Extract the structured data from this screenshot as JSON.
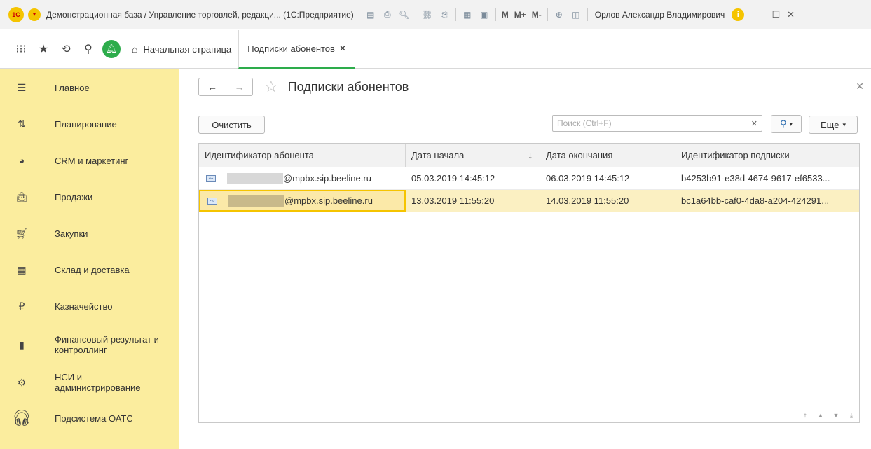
{
  "titlebar": {
    "logo": "1С",
    "title": "Демонстрационная база / Управление торговлей, редакци... (1С:Предприятие)",
    "m_label": "M",
    "mplus_label": "M+",
    "mminus_label": "M-",
    "user": "Орлов Александр Владимирович"
  },
  "tabs": {
    "home": "Начальная страница",
    "active": "Подписки абонентов"
  },
  "sidebar": {
    "items": [
      {
        "label": "Главное"
      },
      {
        "label": "Планирование"
      },
      {
        "label": "CRM и маркетинг"
      },
      {
        "label": "Продажи"
      },
      {
        "label": "Закупки"
      },
      {
        "label": "Склад и доставка"
      },
      {
        "label": "Казначейство"
      },
      {
        "label": "Финансовый результат и контроллинг"
      },
      {
        "label": "НСИ и администрирование"
      },
      {
        "label": "Подсистема ОАТС"
      }
    ]
  },
  "form": {
    "title": "Подписки абонентов",
    "clear_button": "Очистить",
    "search_placeholder": "Поиск (Ctrl+F)",
    "more_button": "Еще",
    "columns": [
      "Идентификатор абонента",
      "Дата начала",
      "Дата окончания",
      "Идентификатор подписки"
    ],
    "rows": [
      {
        "subscriber": "@mpbx.sip.beeline.ru",
        "start": "05.03.2019 14:45:12",
        "end": "06.03.2019 14:45:12",
        "sub_id": "b4253b91-e38d-4674-9617-ef6533..."
      },
      {
        "subscriber": "@mpbx.sip.beeline.ru",
        "start": "13.03.2019 11:55:20",
        "end": "14.03.2019 11:55:20",
        "sub_id": "bc1a64bb-caf0-4da8-a204-424291..."
      }
    ]
  }
}
